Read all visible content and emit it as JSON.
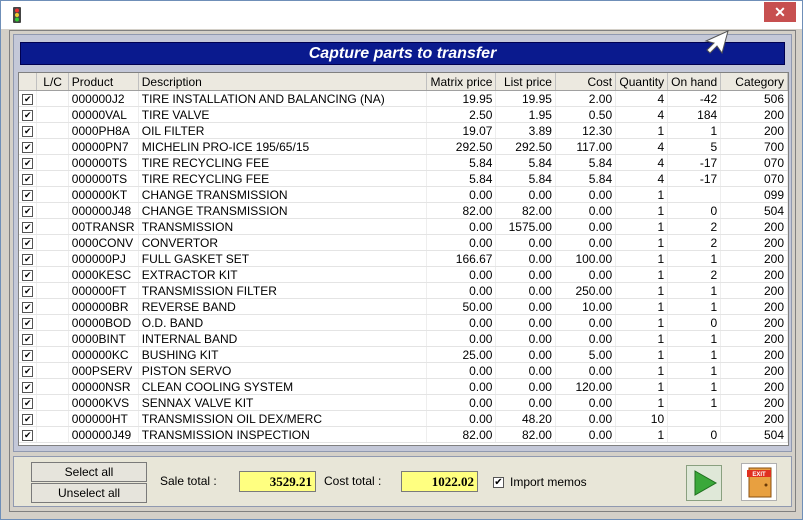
{
  "window": {
    "title": "",
    "close_label": "✕"
  },
  "banner": {
    "title": "Capture parts to transfer"
  },
  "columns": [
    "",
    "L/C",
    "Product",
    "Description",
    "Matrix price",
    "List price",
    "Cost",
    "Quantity",
    "On hand",
    "Category"
  ],
  "rows": [
    {
      "checked": true,
      "lc": "",
      "product": "000000J2",
      "description": "TIRE INSTALLATION AND BALANCING (NA)",
      "matrix": "19.95",
      "list": "19.95",
      "cost": "2.00",
      "qty": "4",
      "onhand": "-42",
      "category": "506"
    },
    {
      "checked": true,
      "lc": "",
      "product": "00000VAL",
      "description": "TIRE VALVE",
      "matrix": "2.50",
      "list": "1.95",
      "cost": "0.50",
      "qty": "4",
      "onhand": "184",
      "category": "200"
    },
    {
      "checked": true,
      "lc": "",
      "product": "0000PH8A",
      "description": "OIL FILTER",
      "matrix": "19.07",
      "list": "3.89",
      "cost": "12.30",
      "qty": "1",
      "onhand": "1",
      "category": "200"
    },
    {
      "checked": true,
      "lc": "",
      "product": "00000PN7",
      "description": "MICHELIN PRO-ICE 195/65/15",
      "matrix": "292.50",
      "list": "292.50",
      "cost": "117.00",
      "qty": "4",
      "onhand": "5",
      "category": "700"
    },
    {
      "checked": true,
      "lc": "",
      "product": "000000TS",
      "description": "TIRE RECYCLING FEE",
      "matrix": "5.84",
      "list": "5.84",
      "cost": "5.84",
      "qty": "4",
      "onhand": "-17",
      "category": "070"
    },
    {
      "checked": true,
      "lc": "",
      "product": "000000TS",
      "description": "TIRE RECYCLING FEE",
      "matrix": "5.84",
      "list": "5.84",
      "cost": "5.84",
      "qty": "4",
      "onhand": "-17",
      "category": "070"
    },
    {
      "checked": true,
      "lc": "",
      "product": "000000KT",
      "description": "CHANGE TRANSMISSION",
      "matrix": "0.00",
      "list": "0.00",
      "cost": "0.00",
      "qty": "1",
      "onhand": "",
      "category": "099"
    },
    {
      "checked": true,
      "lc": "",
      "product": "000000J48",
      "description": "CHANGE TRANSMISSION",
      "matrix": "82.00",
      "list": "82.00",
      "cost": "0.00",
      "qty": "1",
      "onhand": "0",
      "category": "504"
    },
    {
      "checked": true,
      "lc": "",
      "product": "00TRANSR",
      "description": "TRANSMISSION",
      "matrix": "0.00",
      "list": "1575.00",
      "cost": "0.00",
      "qty": "1",
      "onhand": "2",
      "category": "200"
    },
    {
      "checked": true,
      "lc": "",
      "product": "0000CONV",
      "description": "CONVERTOR",
      "matrix": "0.00",
      "list": "0.00",
      "cost": "0.00",
      "qty": "1",
      "onhand": "2",
      "category": "200"
    },
    {
      "checked": true,
      "lc": "",
      "product": "000000PJ",
      "description": "FULL GASKET SET",
      "matrix": "166.67",
      "list": "0.00",
      "cost": "100.00",
      "qty": "1",
      "onhand": "1",
      "category": "200"
    },
    {
      "checked": true,
      "lc": "",
      "product": "0000KESC",
      "description": "EXTRACTOR KIT",
      "matrix": "0.00",
      "list": "0.00",
      "cost": "0.00",
      "qty": "1",
      "onhand": "2",
      "category": "200"
    },
    {
      "checked": true,
      "lc": "",
      "product": "000000FT",
      "description": "TRANSMISSION FILTER",
      "matrix": "0.00",
      "list": "0.00",
      "cost": "250.00",
      "qty": "1",
      "onhand": "1",
      "category": "200"
    },
    {
      "checked": true,
      "lc": "",
      "product": "000000BR",
      "description": "REVERSE BAND",
      "matrix": "50.00",
      "list": "0.00",
      "cost": "10.00",
      "qty": "1",
      "onhand": "1",
      "category": "200"
    },
    {
      "checked": true,
      "lc": "",
      "product": "00000BOD",
      "description": "O.D. BAND",
      "matrix": "0.00",
      "list": "0.00",
      "cost": "0.00",
      "qty": "1",
      "onhand": "0",
      "category": "200"
    },
    {
      "checked": true,
      "lc": "",
      "product": "0000BINT",
      "description": "INTERNAL BAND",
      "matrix": "0.00",
      "list": "0.00",
      "cost": "0.00",
      "qty": "1",
      "onhand": "1",
      "category": "200"
    },
    {
      "checked": true,
      "lc": "",
      "product": "000000KC",
      "description": "BUSHING KIT",
      "matrix": "25.00",
      "list": "0.00",
      "cost": "5.00",
      "qty": "1",
      "onhand": "1",
      "category": "200"
    },
    {
      "checked": true,
      "lc": "",
      "product": "000PSERV",
      "description": "PISTON SERVO",
      "matrix": "0.00",
      "list": "0.00",
      "cost": "0.00",
      "qty": "1",
      "onhand": "1",
      "category": "200"
    },
    {
      "checked": true,
      "lc": "",
      "product": "00000NSR",
      "description": "CLEAN COOLING SYSTEM",
      "matrix": "0.00",
      "list": "0.00",
      "cost": "120.00",
      "qty": "1",
      "onhand": "1",
      "category": "200"
    },
    {
      "checked": true,
      "lc": "",
      "product": "00000KVS",
      "description": "SENNAX VALVE KIT",
      "matrix": "0.00",
      "list": "0.00",
      "cost": "0.00",
      "qty": "1",
      "onhand": "1",
      "category": "200"
    },
    {
      "checked": true,
      "lc": "",
      "product": "000000HT",
      "description": "TRANSMISSION OIL DEX/MERC",
      "matrix": "0.00",
      "list": "48.20",
      "cost": "0.00",
      "qty": "10",
      "onhand": "",
      "category": "200"
    },
    {
      "checked": true,
      "lc": "",
      "product": "000000J49",
      "description": "TRANSMISSION INSPECTION",
      "matrix": "82.00",
      "list": "82.00",
      "cost": "0.00",
      "qty": "1",
      "onhand": "0",
      "category": "504"
    }
  ],
  "footer": {
    "select_all": "Select all",
    "unselect_all": "Unselect all",
    "sale_total_label": "Sale total :",
    "sale_total": "3529.21",
    "cost_total_label": "Cost total :",
    "cost_total": "1022.02",
    "import_memos_label": "Import memos",
    "import_memos_checked": true
  },
  "icons": {
    "app": "traffic-light-icon",
    "play": "play-arrow-icon",
    "exit": "exit-door-icon",
    "cursor": "mouse-pointer-icon"
  },
  "colors": {
    "banner": "#0a1a8e",
    "total_box": "#ffff80",
    "close": "#c75050",
    "play": "#3aa83a"
  }
}
